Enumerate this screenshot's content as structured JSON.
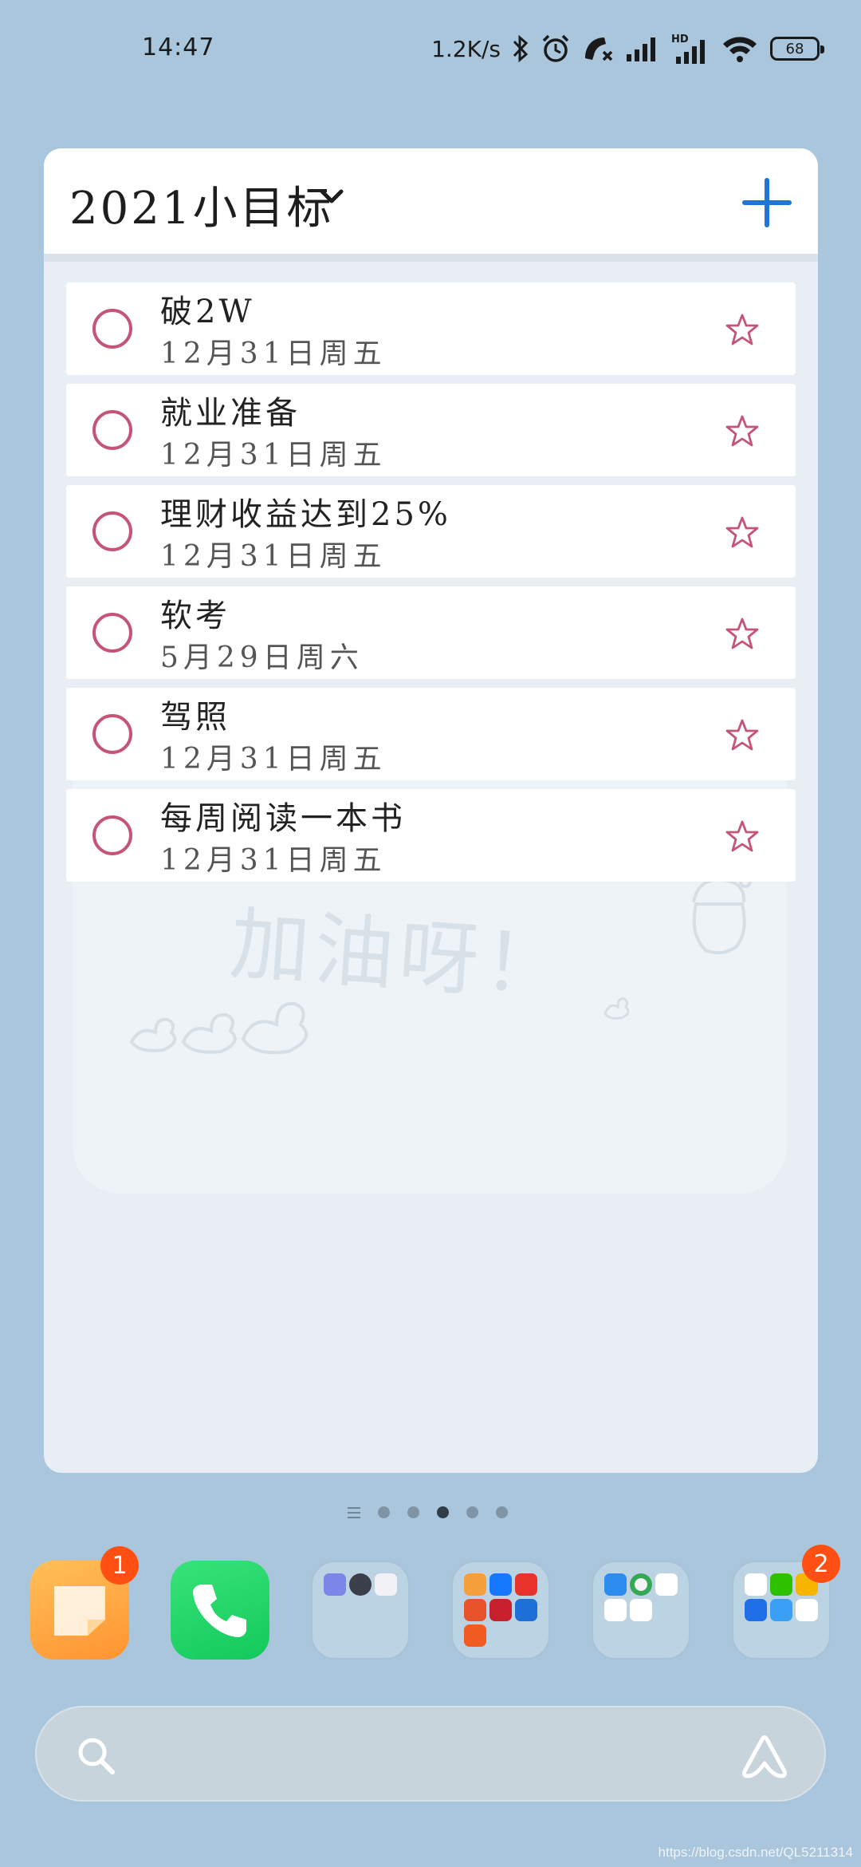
{
  "status_bar": {
    "time": "14:47",
    "net_speed": "1.2K/s",
    "battery": "68",
    "icons": [
      "bluetooth-icon",
      "alarm-icon",
      "call-muted-icon",
      "signal-icon",
      "hd-signal-icon",
      "wifi-icon",
      "battery-icon"
    ]
  },
  "widget": {
    "title": "2021小目标",
    "accent_color": "#c45577",
    "add_color": "#1f74d6",
    "tasks": [
      {
        "title": "破2W",
        "date": "12月31日周五"
      },
      {
        "title": "就业准备",
        "date": "12月31日周五"
      },
      {
        "title": "理财收益达到25%",
        "date": "12月31日周五"
      },
      {
        "title": "软考",
        "date": "5月29日周六"
      },
      {
        "title": "驾照",
        "date": "12月31日周五"
      },
      {
        "title": "每周阅读一本书",
        "date": "12月31日周五"
      }
    ],
    "background_text": "加油呀！"
  },
  "page_indicator": {
    "pages": 5,
    "active": 3
  },
  "dock": {
    "notes_badge": "1",
    "folder4_badge": "2"
  },
  "search": {
    "placeholder": ""
  },
  "watermark": "https://blog.csdn.net/QL5211314"
}
